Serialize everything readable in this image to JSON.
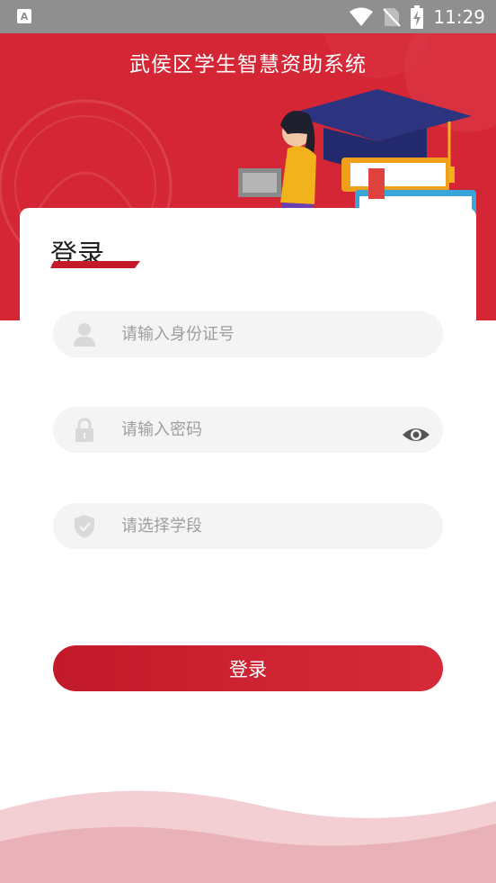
{
  "status_bar": {
    "time": "11:29",
    "notification_icon": "app-a-icon"
  },
  "header": {
    "title": "武侯区学生智慧资助系统"
  },
  "login_card": {
    "heading": "登录",
    "id_field": {
      "placeholder": "请输入身份证号",
      "value": ""
    },
    "password_field": {
      "placeholder": "请输入密码",
      "value": ""
    },
    "stage_field": {
      "placeholder": "请选择学段",
      "value": ""
    },
    "submit_label": "登录"
  },
  "colors": {
    "brand_red": "#d52635",
    "button_red": "#c21a2a",
    "field_bg": "#f4f4f4",
    "placeholder": "#9e9e9e"
  }
}
